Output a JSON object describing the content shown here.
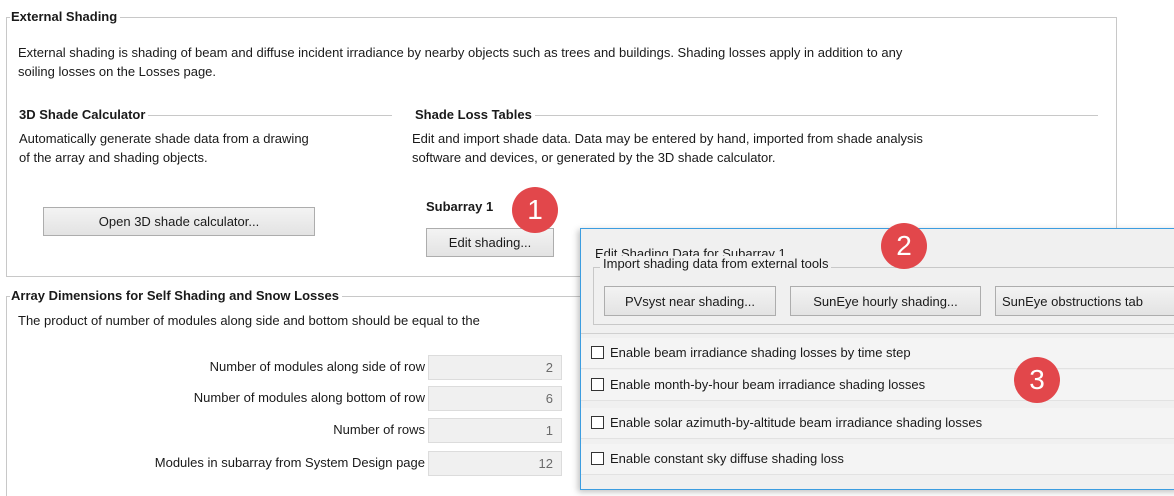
{
  "external_shading": {
    "title": "External Shading",
    "description_line1": "External shading is shading of beam and diffuse incident irradiance by nearby objects such as trees and buildings. Shading losses apply in addition to any",
    "description_line2": "soiling losses on the Losses page.",
    "calculator": {
      "title": "3D Shade Calculator",
      "desc_line1": "Automatically generate shade data from a drawing",
      "desc_line2": "of the array and shading objects.",
      "open_button": "Open 3D shade calculator..."
    },
    "tables": {
      "title": "Shade Loss Tables",
      "desc_line1": "Edit and import shade data. Data may be entered by hand, imported from shade analysis",
      "desc_line2": "software and devices, or generated by the 3D shade calculator.",
      "subarray_label": "Subarray 1",
      "edit_button": "Edit shading..."
    }
  },
  "array_dimensions": {
    "title": "Array Dimensions for Self Shading and Snow Losses",
    "description": "The product of number of modules along side and bottom should be equal to the",
    "fields": [
      {
        "label": "Number of modules along side of row",
        "value": "2"
      },
      {
        "label": "Number of modules along bottom of row",
        "value": "6"
      },
      {
        "label": "Number of rows",
        "value": "1"
      },
      {
        "label": "Modules in subarray from System Design page",
        "value": "12"
      }
    ]
  },
  "dialog": {
    "title": "Edit Shading Data for Subarray 1",
    "import_group": "Import shading data from external tools",
    "buttons": [
      "PVsyst near shading...",
      "SunEye hourly shading...",
      "SunEye obstructions tab"
    ],
    "checkboxes": [
      {
        "label": "Enable beam irradiance shading losses by time step",
        "checked": false
      },
      {
        "label": "Enable month-by-hour beam irradiance shading losses",
        "checked": false
      },
      {
        "label": "Enable solar azimuth-by-altitude beam irradiance shading losses",
        "checked": false
      },
      {
        "label": "Enable constant sky diffuse shading loss",
        "checked": false
      }
    ]
  },
  "callouts": [
    "1",
    "2",
    "3"
  ],
  "colors": {
    "callout": "#e2474b",
    "dialog_border": "#3c9de0",
    "field_bg": "#f0f0f0"
  }
}
